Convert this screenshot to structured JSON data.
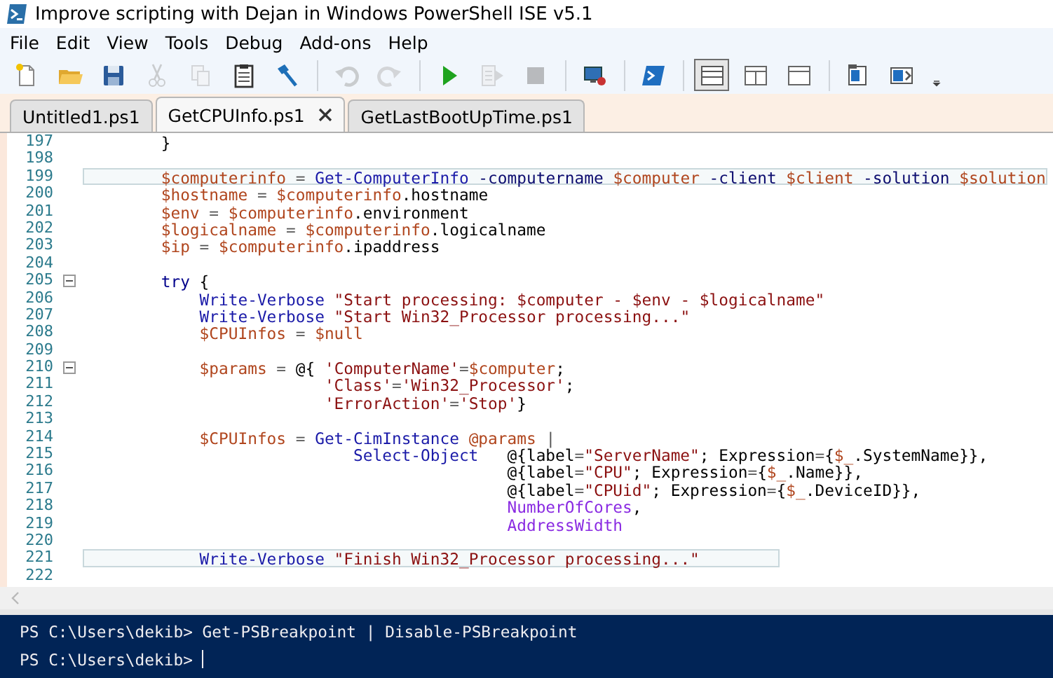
{
  "window": {
    "title": "Improve scripting with Dejan in Windows PowerShell ISE v5.1"
  },
  "menu": [
    "File",
    "Edit",
    "View",
    "Tools",
    "Debug",
    "Add-ons",
    "Help"
  ],
  "toolbar": [
    {
      "kind": "new",
      "disabled": false
    },
    {
      "kind": "open",
      "disabled": false
    },
    {
      "kind": "save",
      "disabled": false
    },
    {
      "kind": "cut",
      "disabled": true
    },
    {
      "kind": "copy",
      "disabled": true
    },
    {
      "kind": "paste",
      "disabled": false
    },
    {
      "kind": "clear",
      "disabled": false
    },
    {
      "kind": "sep"
    },
    {
      "kind": "undo",
      "disabled": true
    },
    {
      "kind": "redo",
      "disabled": true
    },
    {
      "kind": "sep"
    },
    {
      "kind": "run",
      "disabled": false
    },
    {
      "kind": "runsel",
      "disabled": true
    },
    {
      "kind": "stop",
      "disabled": true
    },
    {
      "kind": "sep"
    },
    {
      "kind": "remote",
      "disabled": false
    },
    {
      "kind": "sep"
    },
    {
      "kind": "console",
      "disabled": false
    },
    {
      "kind": "sep"
    },
    {
      "kind": "layout-top",
      "disabled": false,
      "selected": true
    },
    {
      "kind": "layout-right",
      "disabled": false,
      "selected": false
    },
    {
      "kind": "layout-max",
      "disabled": false,
      "selected": false
    },
    {
      "kind": "sep"
    },
    {
      "kind": "script-pane",
      "disabled": false
    },
    {
      "kind": "command-pane",
      "disabled": false
    },
    {
      "kind": "overflow",
      "disabled": false
    }
  ],
  "tabs": [
    {
      "label": "Untitled1.ps1",
      "selected": false
    },
    {
      "label": "GetCPUInfo.ps1",
      "selected": true
    },
    {
      "label": "GetLastBootUpTime.ps1",
      "selected": false
    }
  ],
  "editor": {
    "lines": [
      {
        "number": "197",
        "fold": false,
        "highlighted": false,
        "tokens": [
          {
            "kind": "plain",
            "text": "        }"
          }
        ]
      },
      {
        "number": "198",
        "fold": false,
        "highlighted": false
      },
      {
        "number": "199",
        "fold": false,
        "highlighted": true,
        "tokens": [
          {
            "kind": "variable",
            "text": "        $computerinfo"
          },
          {
            "kind": "operator",
            "text": " = "
          },
          {
            "kind": "command",
            "text": "Get-ComputerInfo"
          },
          {
            "kind": "parameter",
            "text": " -computername "
          },
          {
            "kind": "variable",
            "text": "$computer"
          },
          {
            "kind": "parameter",
            "text": " -client "
          },
          {
            "kind": "variable",
            "text": "$client"
          },
          {
            "kind": "parameter",
            "text": " -solution "
          },
          {
            "kind": "variable",
            "text": "$solution"
          }
        ]
      },
      {
        "number": "200",
        "fold": false,
        "highlighted": false,
        "tokens": [
          {
            "kind": "variable",
            "text": "        $hostname"
          },
          {
            "kind": "operator",
            "text": " = "
          },
          {
            "kind": "variable",
            "text": "$computerinfo"
          },
          {
            "kind": "plain",
            "text": ".hostname"
          }
        ]
      },
      {
        "number": "201",
        "fold": false,
        "highlighted": false,
        "tokens": [
          {
            "kind": "variable",
            "text": "        $env"
          },
          {
            "kind": "operator",
            "text": " = "
          },
          {
            "kind": "variable",
            "text": "$computerinfo"
          },
          {
            "kind": "plain",
            "text": ".environment"
          }
        ]
      },
      {
        "number": "202",
        "fold": false,
        "highlighted": false,
        "tokens": [
          {
            "kind": "variable",
            "text": "        $logicalname"
          },
          {
            "kind": "operator",
            "text": " = "
          },
          {
            "kind": "variable",
            "text": "$computerinfo"
          },
          {
            "kind": "plain",
            "text": ".logicalname"
          }
        ]
      },
      {
        "number": "203",
        "fold": false,
        "highlighted": false,
        "tokens": [
          {
            "kind": "variable",
            "text": "        $ip"
          },
          {
            "kind": "operator",
            "text": " = "
          },
          {
            "kind": "variable",
            "text": "$computerinfo"
          },
          {
            "kind": "plain",
            "text": ".ipaddress"
          }
        ]
      },
      {
        "number": "204",
        "fold": false,
        "highlighted": false
      },
      {
        "number": "205",
        "fold": true,
        "highlighted": false,
        "tokens": [
          {
            "kind": "keyword",
            "text": "        try"
          },
          {
            "kind": "plain",
            "text": " {"
          }
        ]
      },
      {
        "number": "206",
        "fold": false,
        "highlighted": false,
        "tokens": [
          {
            "kind": "command",
            "text": "            Write-Verbose"
          },
          {
            "kind": "string",
            "text": " \"Start processing: $computer - $env - $logicalname\""
          }
        ]
      },
      {
        "number": "207",
        "fold": false,
        "highlighted": false,
        "tokens": [
          {
            "kind": "command",
            "text": "            Write-Verbose"
          },
          {
            "kind": "string",
            "text": " \"Start Win32_Processor processing...\""
          }
        ]
      },
      {
        "number": "208",
        "fold": false,
        "highlighted": false,
        "tokens": [
          {
            "kind": "variable",
            "text": "            $CPUInfos"
          },
          {
            "kind": "operator",
            "text": " = "
          },
          {
            "kind": "variable",
            "text": "$null"
          }
        ]
      },
      {
        "number": "209",
        "fold": false,
        "highlighted": false
      },
      {
        "number": "210",
        "fold": true,
        "highlighted": false,
        "tokens": [
          {
            "kind": "variable",
            "text": "            $params"
          },
          {
            "kind": "operator",
            "text": " = "
          },
          {
            "kind": "plain",
            "text": "@{ "
          },
          {
            "kind": "string",
            "text": "'ComputerName'"
          },
          {
            "kind": "operator",
            "text": "="
          },
          {
            "kind": "variable",
            "text": "$computer"
          },
          {
            "kind": "plain",
            "text": ";"
          }
        ]
      },
      {
        "number": "211",
        "fold": false,
        "highlighted": false,
        "tokens": [
          {
            "kind": "string",
            "text": "                         'Class'"
          },
          {
            "kind": "operator",
            "text": "="
          },
          {
            "kind": "string",
            "text": "'Win32_Processor'"
          },
          {
            "kind": "plain",
            "text": ";"
          }
        ]
      },
      {
        "number": "212",
        "fold": false,
        "highlighted": false,
        "tokens": [
          {
            "kind": "string",
            "text": "                         'ErrorAction'"
          },
          {
            "kind": "operator",
            "text": "="
          },
          {
            "kind": "string",
            "text": "'Stop'"
          },
          {
            "kind": "plain",
            "text": "}"
          }
        ]
      },
      {
        "number": "213",
        "fold": false,
        "highlighted": false
      },
      {
        "number": "214",
        "fold": false,
        "highlighted": false,
        "tokens": [
          {
            "kind": "variable",
            "text": "            $CPUInfos"
          },
          {
            "kind": "operator",
            "text": " = "
          },
          {
            "kind": "command",
            "text": "Get-CimInstance"
          },
          {
            "kind": "variable",
            "text": " @params"
          },
          {
            "kind": "operator",
            "text": " |"
          }
        ]
      },
      {
        "number": "215",
        "fold": false,
        "highlighted": false,
        "tokens": [
          {
            "kind": "command",
            "text": "                            Select-Object"
          },
          {
            "kind": "plain",
            "text": "   @{label"
          },
          {
            "kind": "operator",
            "text": "="
          },
          {
            "kind": "string",
            "text": "\"ServerName\""
          },
          {
            "kind": "plain",
            "text": "; Expression"
          },
          {
            "kind": "operator",
            "text": "="
          },
          {
            "kind": "plain",
            "text": "{"
          },
          {
            "kind": "variable",
            "text": "$_"
          },
          {
            "kind": "plain",
            "text": ".SystemName}},"
          }
        ]
      },
      {
        "number": "216",
        "fold": false,
        "highlighted": false,
        "tokens": [
          {
            "kind": "plain",
            "text": "                                            @{label"
          },
          {
            "kind": "operator",
            "text": "="
          },
          {
            "kind": "string",
            "text": "\"CPU\""
          },
          {
            "kind": "plain",
            "text": "; Expression"
          },
          {
            "kind": "operator",
            "text": "="
          },
          {
            "kind": "plain",
            "text": "{"
          },
          {
            "kind": "variable",
            "text": "$_"
          },
          {
            "kind": "plain",
            "text": ".Name}},"
          }
        ]
      },
      {
        "number": "217",
        "fold": false,
        "highlighted": false,
        "tokens": [
          {
            "kind": "plain",
            "text": "                                            @{label"
          },
          {
            "kind": "operator",
            "text": "="
          },
          {
            "kind": "string",
            "text": "\"CPUid\""
          },
          {
            "kind": "plain",
            "text": "; Expression"
          },
          {
            "kind": "operator",
            "text": "="
          },
          {
            "kind": "plain",
            "text": "{"
          },
          {
            "kind": "variable",
            "text": "$_"
          },
          {
            "kind": "plain",
            "text": ".DeviceID}},"
          }
        ]
      },
      {
        "number": "218",
        "fold": false,
        "highlighted": false,
        "tokens": [
          {
            "kind": "member",
            "text": "                                            NumberOfCores"
          },
          {
            "kind": "plain",
            "text": ","
          }
        ]
      },
      {
        "number": "219",
        "fold": false,
        "highlighted": false,
        "tokens": [
          {
            "kind": "member",
            "text": "                                            AddressWidth"
          }
        ]
      },
      {
        "number": "220",
        "fold": false,
        "highlighted": false
      },
      {
        "number": "221",
        "fold": false,
        "highlighted": true,
        "tokens": [
          {
            "kind": "command",
            "text": "            Write-Verbose"
          },
          {
            "kind": "string",
            "text": " \"Finish Win32_Processor processing...\""
          }
        ]
      },
      {
        "number": "222",
        "fold": false,
        "highlighted": false
      }
    ]
  },
  "console": {
    "lines": [
      {
        "text": "PS C:\\Users\\dekib> Get-PSBreakpoint | Disable-PSBreakpoint",
        "cursor": false
      },
      {
        "text": "PS C:\\Users\\dekib> ",
        "cursor": true
      }
    ]
  }
}
